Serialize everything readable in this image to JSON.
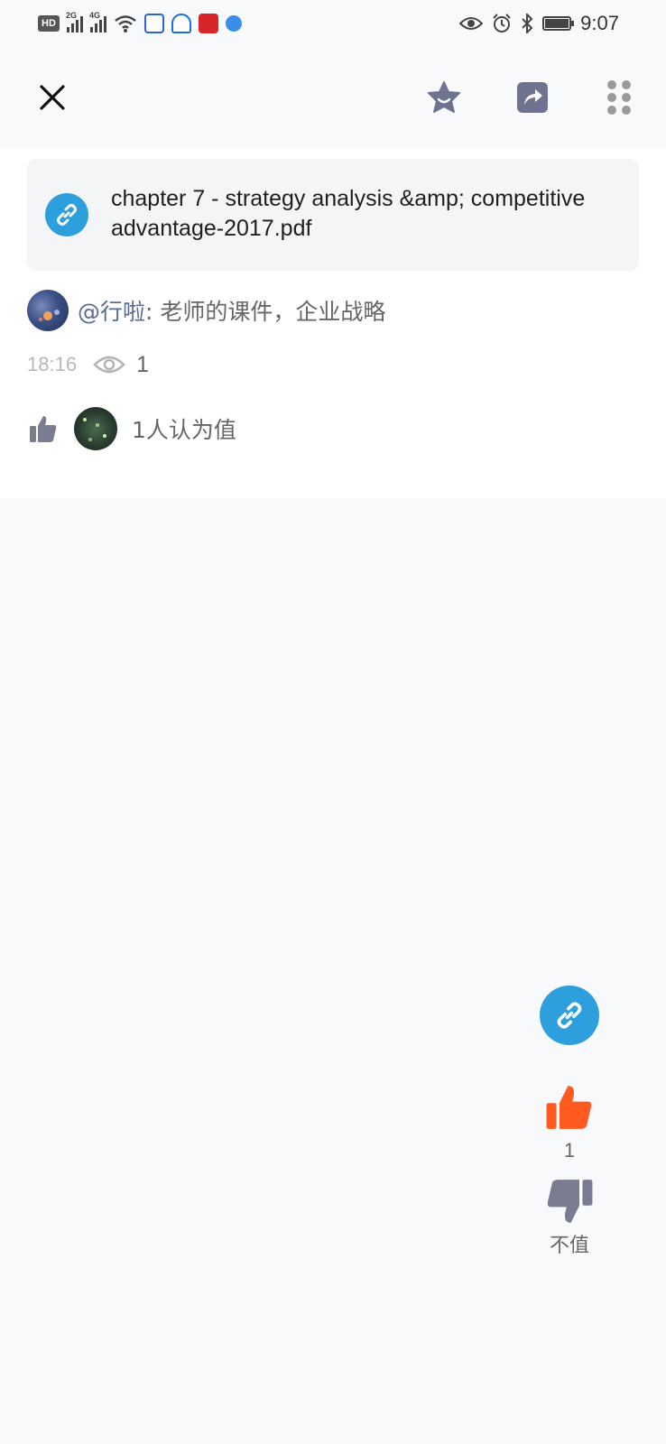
{
  "status_bar": {
    "hd_label": "HD",
    "sim1_label": "2G",
    "sim2_label": "4G",
    "time": "9:07"
  },
  "nav": {
    "close_icon": "close-icon",
    "favorite_icon": "star-icon",
    "share_icon": "share-icon",
    "more_icon": "more-dots-icon"
  },
  "post": {
    "link_title": "chapter 7 - strategy analysis &amp; competitive advantage-2017.pdf",
    "author": "@行啦",
    "content": ": 老师的课件，企业战略",
    "time": "18:16",
    "views": "1",
    "likes_text": "1人认为值"
  },
  "actions": {
    "worth_count": "1",
    "not_worth_label": "不值",
    "colors": {
      "accent_blue": "#2d9fdc",
      "worth_orange": "#ff5a1f",
      "gray_icon": "#7a7d92"
    }
  }
}
